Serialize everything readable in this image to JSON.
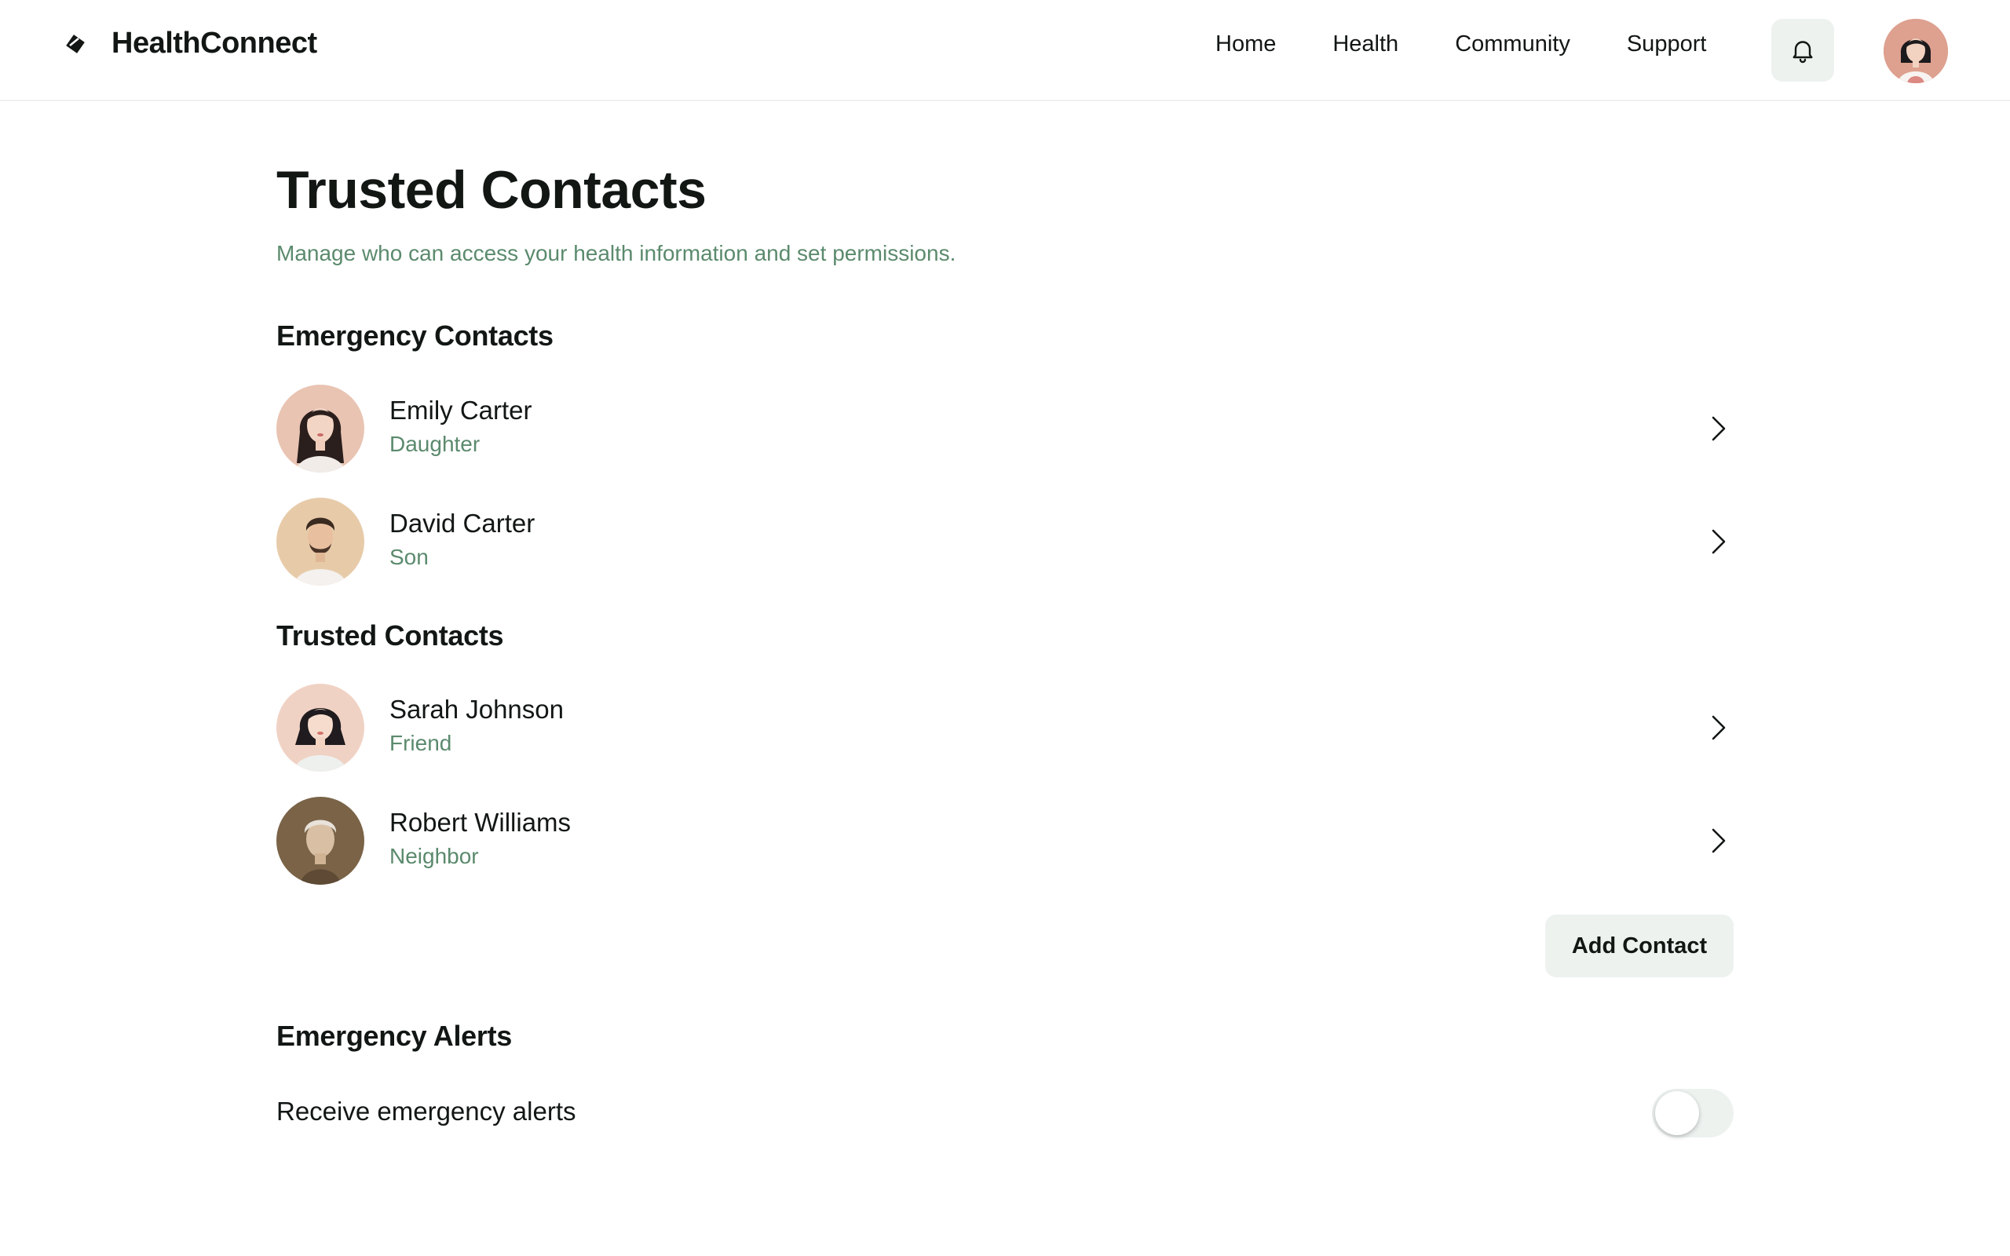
{
  "app": {
    "name": "HealthConnect",
    "logo_icon": "leaf-logo-icon"
  },
  "nav": {
    "items": [
      "Home",
      "Health",
      "Community",
      "Support"
    ],
    "notifications_icon": "bell-icon"
  },
  "page": {
    "title": "Trusted Contacts",
    "subtitle": "Manage who can access your health information and set permissions."
  },
  "sections": {
    "emergency_title": "Emergency Contacts",
    "trusted_title": "Trusted Contacts",
    "alerts_title": "Emergency Alerts"
  },
  "emergency_contacts": [
    {
      "name": "Emily Carter",
      "relation": "Daughter"
    },
    {
      "name": "David Carter",
      "relation": "Son"
    }
  ],
  "trusted_contacts": [
    {
      "name": "Sarah Johnson",
      "relation": "Friend"
    },
    {
      "name": "Robert Williams",
      "relation": "Neighbor"
    }
  ],
  "actions": {
    "add_contact": "Add Contact"
  },
  "alerts": {
    "receive_label": "Receive emergency alerts",
    "receive_enabled": false
  },
  "colors": {
    "accent_text": "#5b8a6d",
    "button_bg": "#edf2ef",
    "text": "#121714"
  }
}
